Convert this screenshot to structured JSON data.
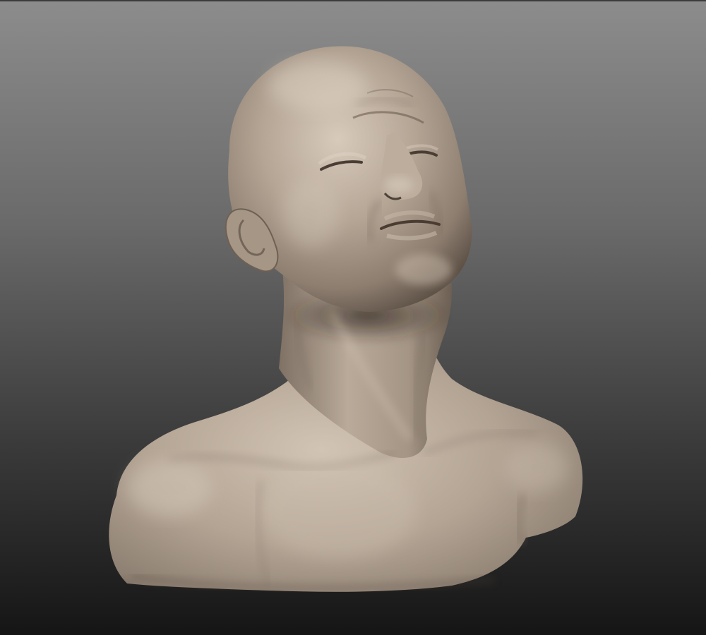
{
  "viewport": {
    "background_top_color": "#8a8a8a",
    "background_bottom_color": "#161616",
    "frame_line_color": "#3c3c3c"
  },
  "model": {
    "subject": "sculpted-bust",
    "material_base_color": "#a8998a",
    "material_highlight_color": "#d6c8b8",
    "material_shadow_color": "#4a3d33"
  }
}
